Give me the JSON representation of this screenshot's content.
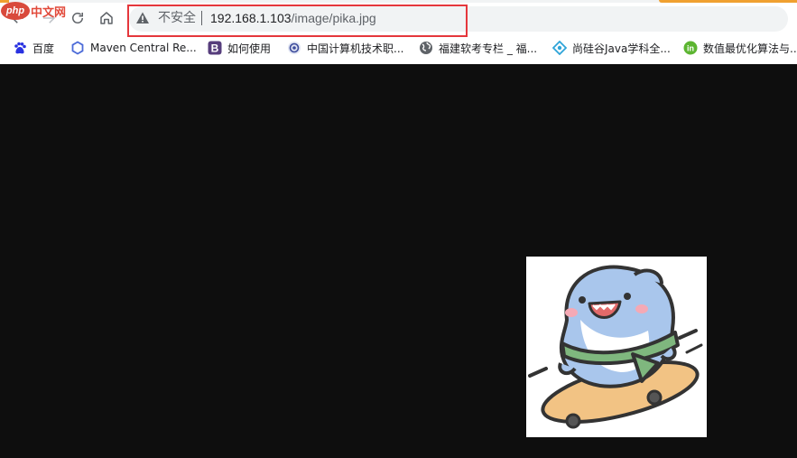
{
  "toolbar": {
    "security_label": "不安全",
    "url_host": "192.168.1.103",
    "url_path": "/image/pika.jpg",
    "watermark_text": "中文网",
    "watermark_badge": "php"
  },
  "bookmarks": [
    {
      "label": "百度",
      "icon": "baidu-paw-icon"
    },
    {
      "label": "Maven Central Re...",
      "icon": "hexagon-icon"
    },
    {
      "label": "如何使用",
      "icon": "bootstrap-b-icon"
    },
    {
      "label": "中国计算机技术职...",
      "icon": "eye-logo-icon"
    },
    {
      "label": "福建软考专栏 _ 福...",
      "icon": "globe-icon"
    },
    {
      "label": "尚硅谷Java学科全...",
      "icon": "diamond-logo-icon"
    },
    {
      "label": "数值最优化算法与...",
      "icon": "in-badge-icon"
    }
  ],
  "page": {
    "image_alt": "pika.jpg",
    "background_color": "#0e0e0e"
  }
}
